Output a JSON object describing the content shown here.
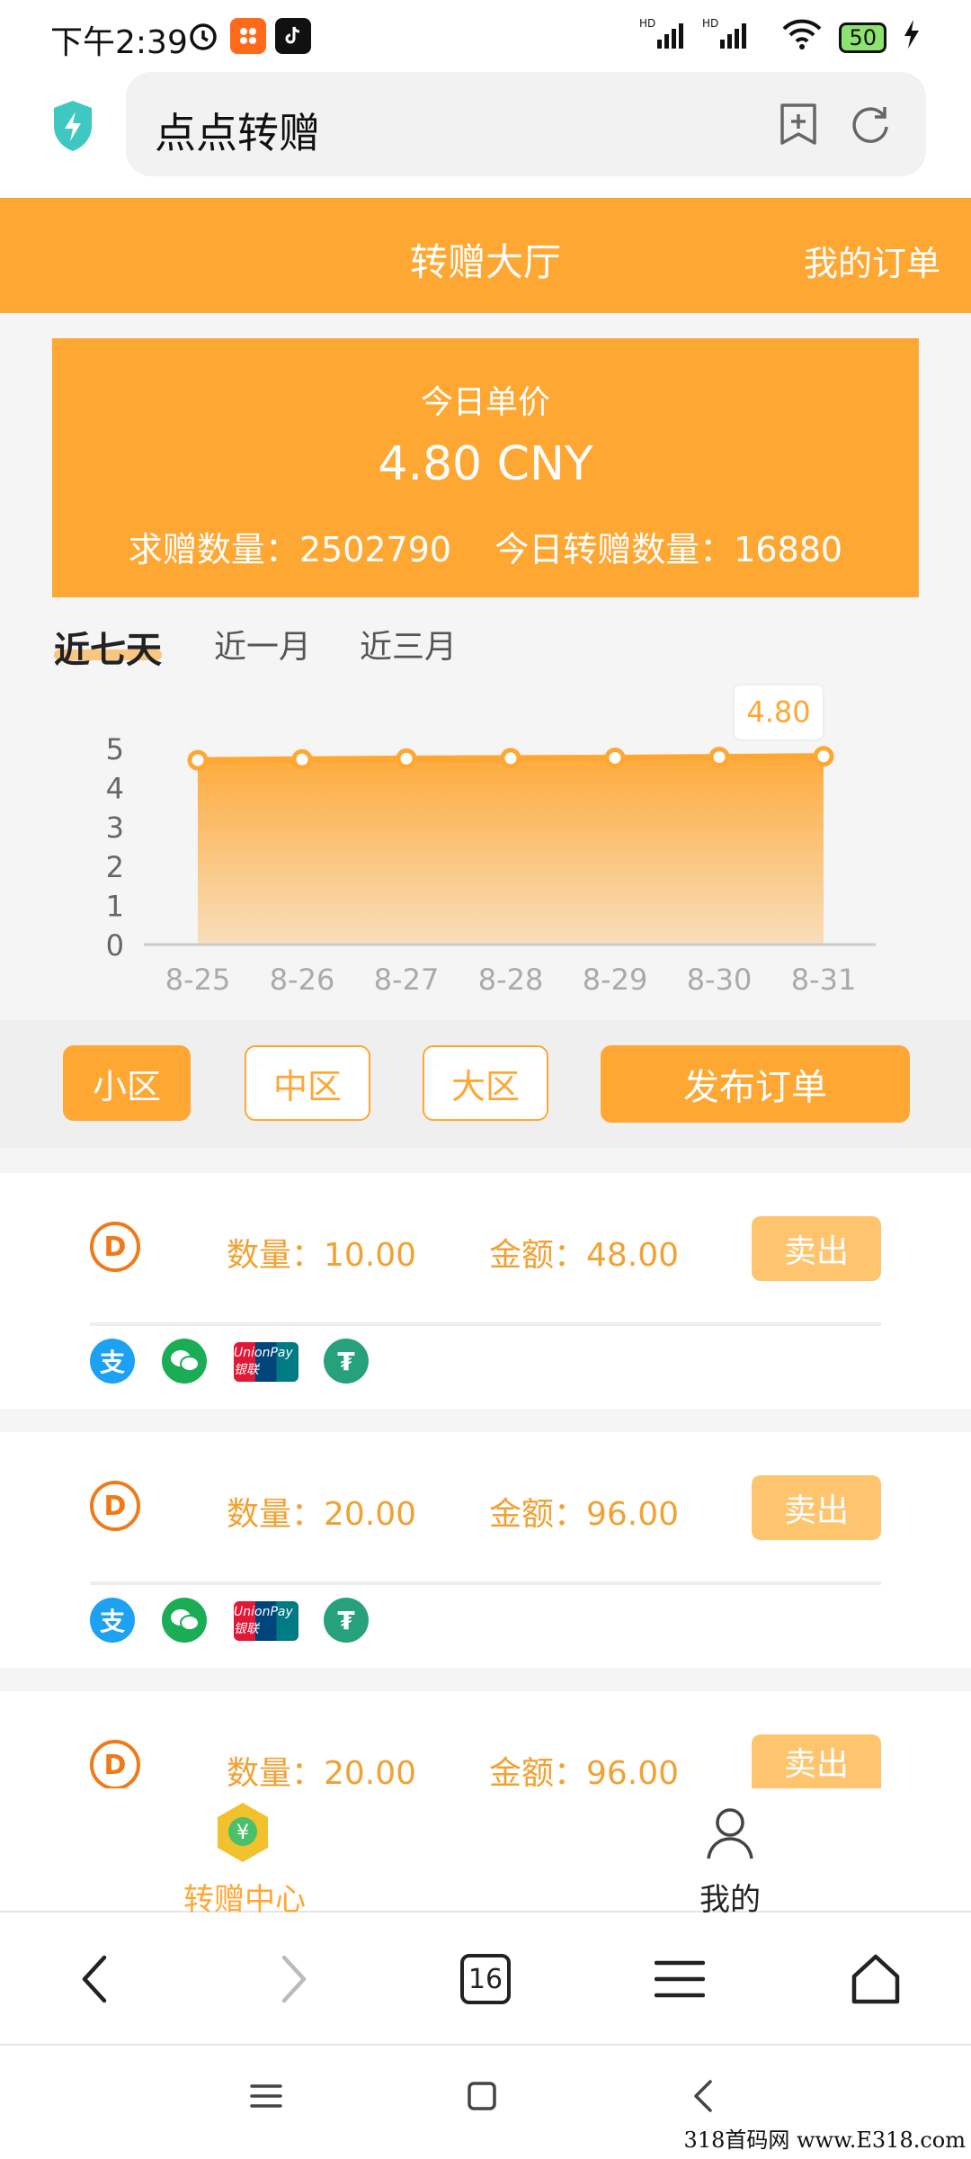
{
  "status_bar": {
    "time": "下午2:39",
    "battery": "50",
    "icons": [
      "alarm-icon",
      "app-notification-icon",
      "tiktok-icon",
      "hd-signal-icon",
      "wifi-icon",
      "charging-icon"
    ]
  },
  "browser": {
    "url_title": "点点转赠",
    "tab_count": "16"
  },
  "header": {
    "title": "转赠大厅",
    "my_orders": "我的订单"
  },
  "price_card": {
    "label": "今日单价",
    "value": "4.80 CNY",
    "request_label": "求赠数量：2502790",
    "today_label": "今日转赠数量：16880"
  },
  "range_tabs": [
    {
      "label": "近七天",
      "active": true
    },
    {
      "label": "近一月",
      "active": false
    },
    {
      "label": "近三月",
      "active": false
    }
  ],
  "chart_data": {
    "type": "area",
    "categories": [
      "8-25",
      "8-26",
      "8-27",
      "8-28",
      "8-29",
      "8-30",
      "8-31"
    ],
    "values": [
      4.7,
      4.72,
      4.74,
      4.75,
      4.76,
      4.78,
      4.8
    ],
    "ylim": [
      0,
      5
    ],
    "yticks": [
      0,
      1,
      2,
      3,
      4,
      5
    ],
    "tooltip": "4.80",
    "color": "#ffa733"
  },
  "zones": [
    {
      "label": "小区",
      "active": true
    },
    {
      "label": "中区",
      "active": false
    },
    {
      "label": "大区",
      "active": false
    }
  ],
  "publish_label": "发布订单",
  "orders": [
    {
      "qty": "数量：10.00",
      "amount": "金额：48.00",
      "action": "卖出"
    },
    {
      "qty": "数量：20.00",
      "amount": "金额：96.00",
      "action": "卖出"
    },
    {
      "qty": "数量：20.00",
      "amount": "金额：96.00",
      "action": "卖出"
    }
  ],
  "payment_methods": {
    "alipay": "支",
    "unionpay": "UnionPay 银联",
    "tether": "₮"
  },
  "tab_bar": {
    "center": "转赠中心",
    "center_icon": "¥",
    "mine": "我的"
  },
  "watermark": "318首码网 www.E318.com",
  "colors": {
    "accent": "#ffa733",
    "text_orange": "#f0a234",
    "sell_button": "#ffc46e"
  }
}
